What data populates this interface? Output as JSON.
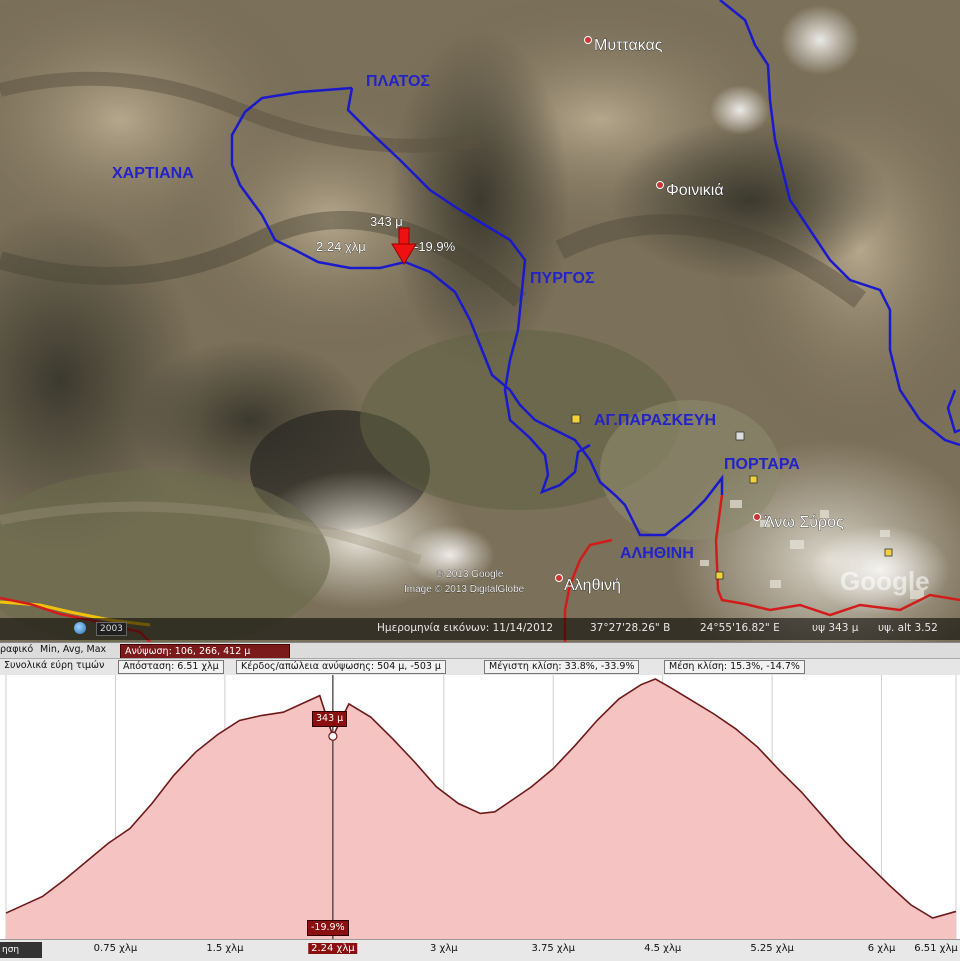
{
  "colors": {
    "track": "#1a1acc",
    "road": "#d21c1c",
    "yellow_road": "#f2c20a",
    "place_label": "#2323c8",
    "profile_fill": "#f6c3c3",
    "profile_line": "#6e1a1a",
    "marker_red": "#e11"
  },
  "map": {
    "area_labels": {
      "platos": "ΠΛΑΤΟΣ",
      "chartiana": "ΧΑΡΤΙΑΝΑ",
      "pyrgos": "ΠΥΡΓΟΣ",
      "ag_paraskevi": "ΑΓ.ΠΑΡΑΣΚΕΥΗ",
      "portara": "ΠΟΡΤΑΡΑ",
      "alithini_caps": "ΑΛΗΘΙΝΗ"
    },
    "places": {
      "muttakas": "Μυττακας",
      "foinikia": "Φοινικιά",
      "ano_syros": "Άνω Σύρος",
      "alithini": "Αληθινή"
    },
    "cursor": {
      "elevation": "343 μ",
      "distance": "2.24 χλμ",
      "slope": "-19.9%"
    },
    "copyright": {
      "line1": "© 2013 Google",
      "line2": "Image © 2013 DigitalGlobe"
    },
    "google_logo": "Google",
    "status": {
      "year": "2003",
      "imagery_date": "Ημερομηνία εικόνων: 11/14/2012",
      "lat": "37°27'28.26\" B",
      "lon": "24°55'16.82\" E",
      "elev": "υψ 343 μ",
      "eye_alt": "υψ. alt 3.52"
    }
  },
  "profile": {
    "header1": {
      "graph_label": "ραφικό",
      "min_avg_max_label": "Min, Avg, Max",
      "elevation_value": "Ανύψωση: 106, 266, 412 μ"
    },
    "header2": {
      "range_label": "Συνολικά εύρη τιμών",
      "distance": "Απόσταση: 6.51 χλμ",
      "gain_loss": "Κέρδος/απώλεια ανύψωσης: 504 μ, -503 μ",
      "max_slope": "Μέγιστη κλίση: 33.8%, -33.9%",
      "avg_slope": "Μέση κλίση: 15.3%, -14.7%"
    },
    "cursor_elev_tag": "343 μ",
    "cursor_slope_tag": "-19.9%",
    "left_box": "ηση",
    "x_ticks": [
      "0.75 χλμ",
      "1.5 χλμ",
      "2.24 χλμ",
      "3 χλμ",
      "3.75 χλμ",
      "4.5 χλμ",
      "5.25 χλμ",
      "6 χλμ",
      "6.51 χλμ"
    ]
  },
  "chart_data": {
    "type": "area",
    "title": "",
    "xlabel": "",
    "ylabel": "",
    "x_unit": "χλμ",
    "y_unit": "μ",
    "xlim": [
      0,
      6.51
    ],
    "ylim": [
      106,
      412
    ],
    "cursor": {
      "x": 2.24,
      "y": 343,
      "slope": "-19.9%"
    },
    "series": [
      {
        "x": [
          0,
          0.1,
          0.25,
          0.4,
          0.55,
          0.7,
          0.85,
          1.0,
          1.15,
          1.3,
          1.45,
          1.6,
          1.75,
          1.9,
          2.05,
          2.15,
          2.24,
          2.35,
          2.5,
          2.65,
          2.8,
          2.95,
          3.1,
          3.25,
          3.35,
          3.45,
          3.6,
          3.75,
          3.9,
          4.05,
          4.2,
          4.35,
          4.45,
          4.55,
          4.7,
          4.85,
          5.0,
          5.15,
          5.3,
          5.45,
          5.6,
          5.75,
          5.9,
          6.05,
          6.2,
          6.35,
          6.51
        ],
        "y": [
          130,
          138,
          150,
          170,
          192,
          214,
          232,
          262,
          296,
          324,
          345,
          362,
          368,
          372,
          384,
          392,
          343,
          382,
          366,
          340,
          312,
          282,
          262,
          250,
          252,
          264,
          282,
          304,
          332,
          362,
          388,
          405,
          412,
          402,
          386,
          370,
          352,
          330,
          302,
          276,
          246,
          216,
          190,
          164,
          140,
          124,
          132
        ]
      }
    ]
  }
}
